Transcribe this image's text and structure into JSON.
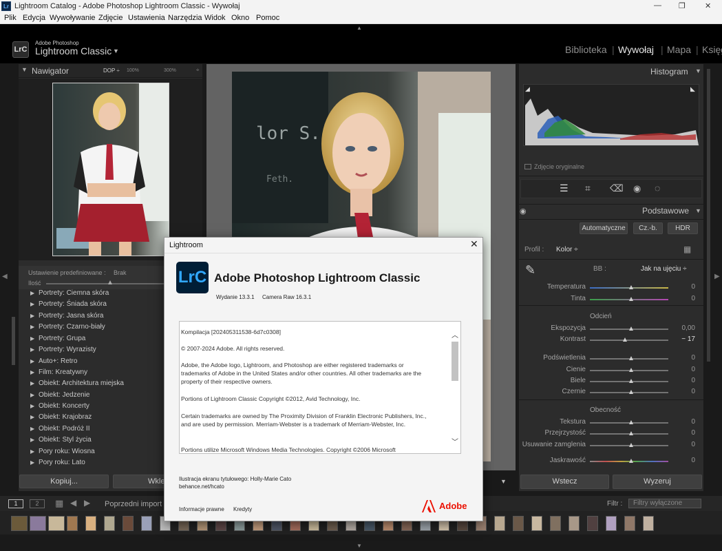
{
  "window": {
    "title": "Lightroom Catalog - Adobe Photoshop Lightroom Classic - Wywołaj",
    "controls": [
      "—",
      "❐",
      "✕"
    ]
  },
  "menu": [
    "Plik",
    "Edycja",
    "Wywoływanie",
    "Zdjęcie",
    "Ustawienia",
    "Narzędzia",
    "Widok",
    "Okno",
    "Pomoc"
  ],
  "header": {
    "logo": "LrC",
    "brand_line1": "Adobe Photoshop",
    "brand_line2": "Lightroom Classic",
    "modules": [
      "Biblioteka",
      "Wywołaj",
      "Mapa",
      "Księg"
    ],
    "active_module": "Wywołaj"
  },
  "navigator": {
    "title": "Nawigator",
    "zoom": [
      "DOP ÷",
      "100%",
      "300%",
      "÷"
    ]
  },
  "presets": {
    "header_label": "Ustawienie predefiniowane :",
    "header_value": "Brak",
    "amount_label": "Ilość",
    "items": [
      "Portrety: Ciemna skóra",
      "Portrety: Śniada skóra",
      "Portrety: Jasna skóra",
      "Portrety: Czarno-biały",
      "Portrety: Grupa",
      "Portrety: Wyrazisty",
      "Auto+: Retro",
      "Film: Kreatywny",
      "Obiekt: Architektura miejska",
      "Obiekt: Jedzenie",
      "Obiekt: Koncerty",
      "Obiekt: Krajobraz",
      "Obiekt: Podróż II",
      "Obiekt: Styl życia",
      "Pory roku: Wiosna",
      "Pory roku: Lato"
    ]
  },
  "left_buttons": {
    "copy": "Kopiuj...",
    "paste": "Wkle"
  },
  "histogram": {
    "title": "Histogram",
    "original_photo": "Zdjęcie oryginalne"
  },
  "basic": {
    "title": "Podstawowe",
    "auto": "Automatyczne",
    "bw": "Cz.-b.",
    "hdr": "HDR",
    "profile_label": "Profil :",
    "profile_value": "Kolor ÷",
    "wb_label": "BB :",
    "wb_value": "Jak na ujęciu ÷",
    "tone_section": "Odcień",
    "presence_section": "Obecność",
    "sliders": [
      {
        "label": "Temperatura",
        "value": "0"
      },
      {
        "label": "Tinta",
        "value": "0"
      },
      {
        "label": "Ekspozycja",
        "value": "0,00"
      },
      {
        "label": "Kontrast",
        "value": "− 17"
      },
      {
        "label": "Podświetlenia",
        "value": "0"
      },
      {
        "label": "Cienie",
        "value": "0"
      },
      {
        "label": "Biele",
        "value": "0"
      },
      {
        "label": "Czernie",
        "value": "0"
      },
      {
        "label": "Tekstura",
        "value": "0"
      },
      {
        "label": "Przejrzystość",
        "value": "0"
      },
      {
        "label": "Usuwanie zamglenia",
        "value": "0"
      },
      {
        "label": "Jaskrawość",
        "value": "0"
      }
    ]
  },
  "right_buttons": {
    "previous": "Wstecz",
    "reset": "Wyzeruj"
  },
  "filmbar": {
    "screen1": "1",
    "screen2": "2",
    "source": "Poprzedni import",
    "filter_label": "Filtr :",
    "filter_value": "Filtry wyłączone"
  },
  "dialog": {
    "title": "Lightroom",
    "close": "✕",
    "logo": "LrC",
    "product": "Adobe Photoshop Lightroom Classic",
    "version": "Wydanie 13.3.1",
    "camera_raw": "Camera Raw 16.3.1",
    "text": [
      "Kompilacja [202405311538-6d7c0308]",
      "© 2007-2024 Adobe. All rights reserved.",
      "Adobe, the Adobe logo, Lightroom, and Photoshop are either registered trademarks or trademarks of Adobe in the United States and/or other countries. All other trademarks are the property of their respective owners.",
      "Portions of Lightroom Classic Copyright ©2012, Avid Technology, Inc.",
      "Certain trademarks are owned by The Proximity Division of Franklin Electronic Publishers, Inc., and are used by permission. Merriam-Webster is a trademark of Merriam-Webster, Inc.",
      "Portions utilize Microsoft Windows Media Technologies. Copyright ©2006 Microsoft"
    ],
    "splash_credit": "Ilustracja ekranu tytułowego: Holly-Marie Cato",
    "splash_link": "behance.net/hcato",
    "legal": "Informacje prawne",
    "credits": "Kredyty",
    "adobe": "Adobe"
  }
}
